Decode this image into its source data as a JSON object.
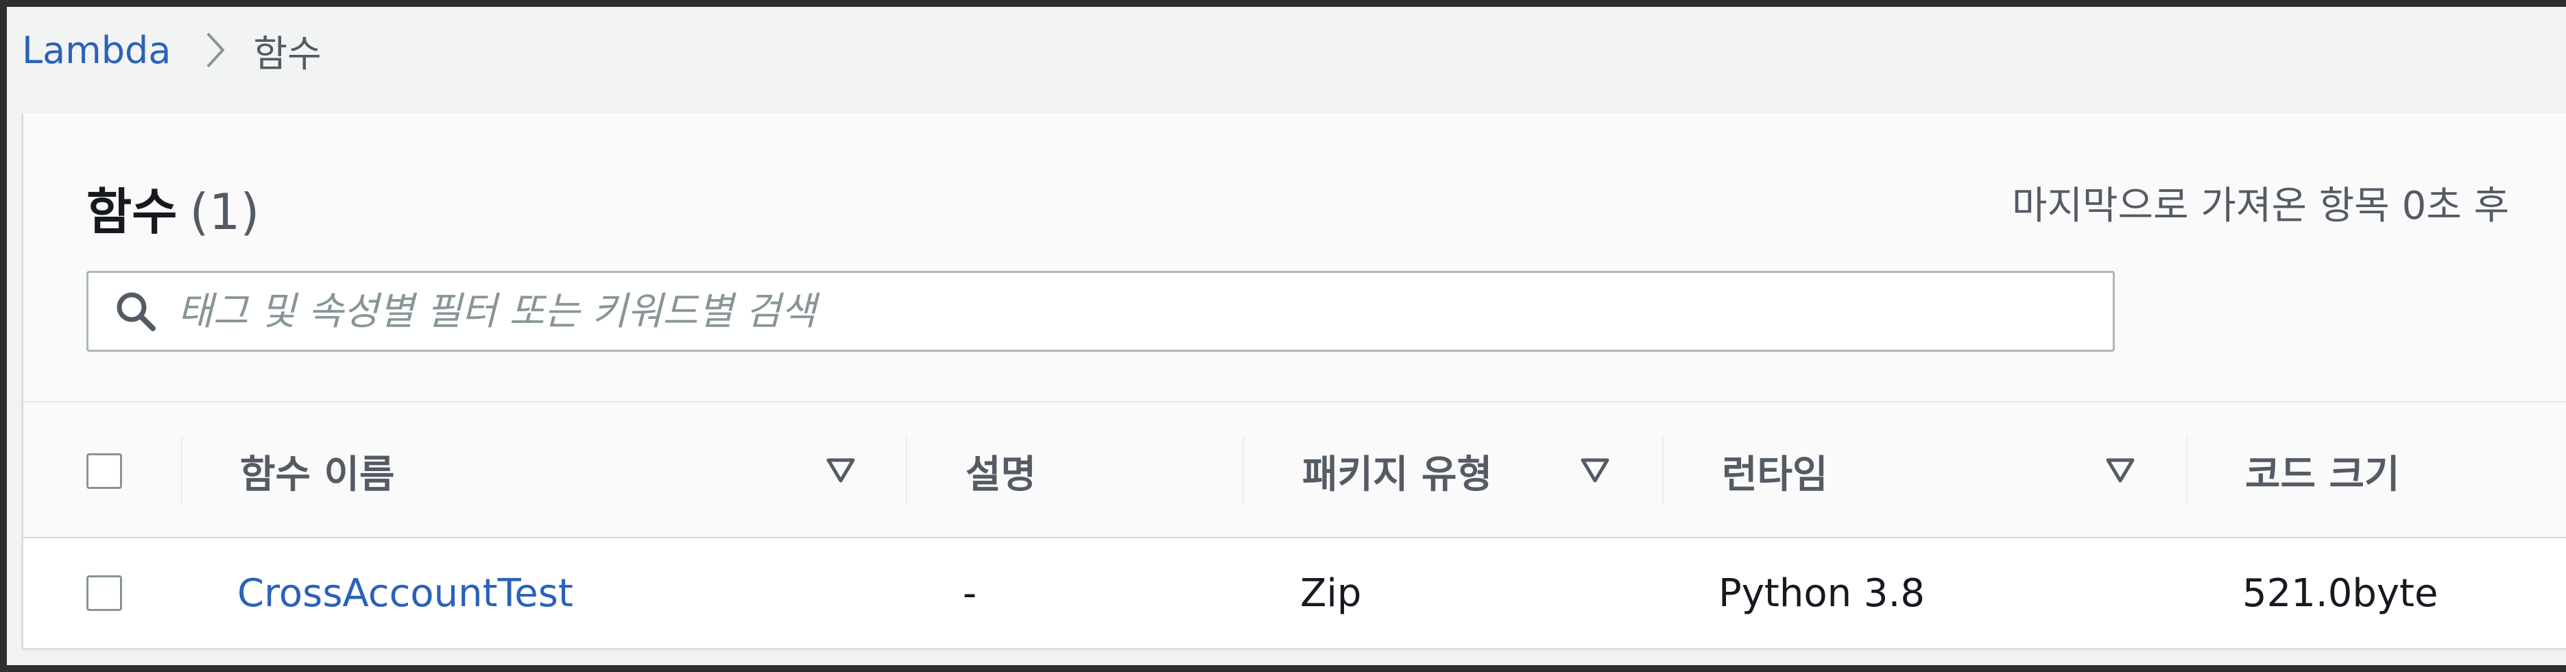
{
  "breadcrumb": {
    "root": "Lambda",
    "current": "함수"
  },
  "panel": {
    "title": "함수",
    "count": "(1)",
    "last_fetched": "마지막으로 가져온 항목 0초 후"
  },
  "search": {
    "placeholder": "태그 및 속성별 필터 또는 키워드별 검색",
    "icon": "search-icon"
  },
  "table": {
    "columns": [
      "함수 이름",
      "설명",
      "패키지 유형",
      "런타임",
      "코드 크기"
    ],
    "rows": [
      {
        "name": "CrossAccountTest",
        "description": "-",
        "package_type": "Zip",
        "runtime": "Python 3.8",
        "code_size": "521.0byte"
      }
    ]
  },
  "colors": {
    "link": "#2a62b8",
    "header_text": "#545b64",
    "title_text": "#16191f",
    "background": "#f2f3f3"
  }
}
